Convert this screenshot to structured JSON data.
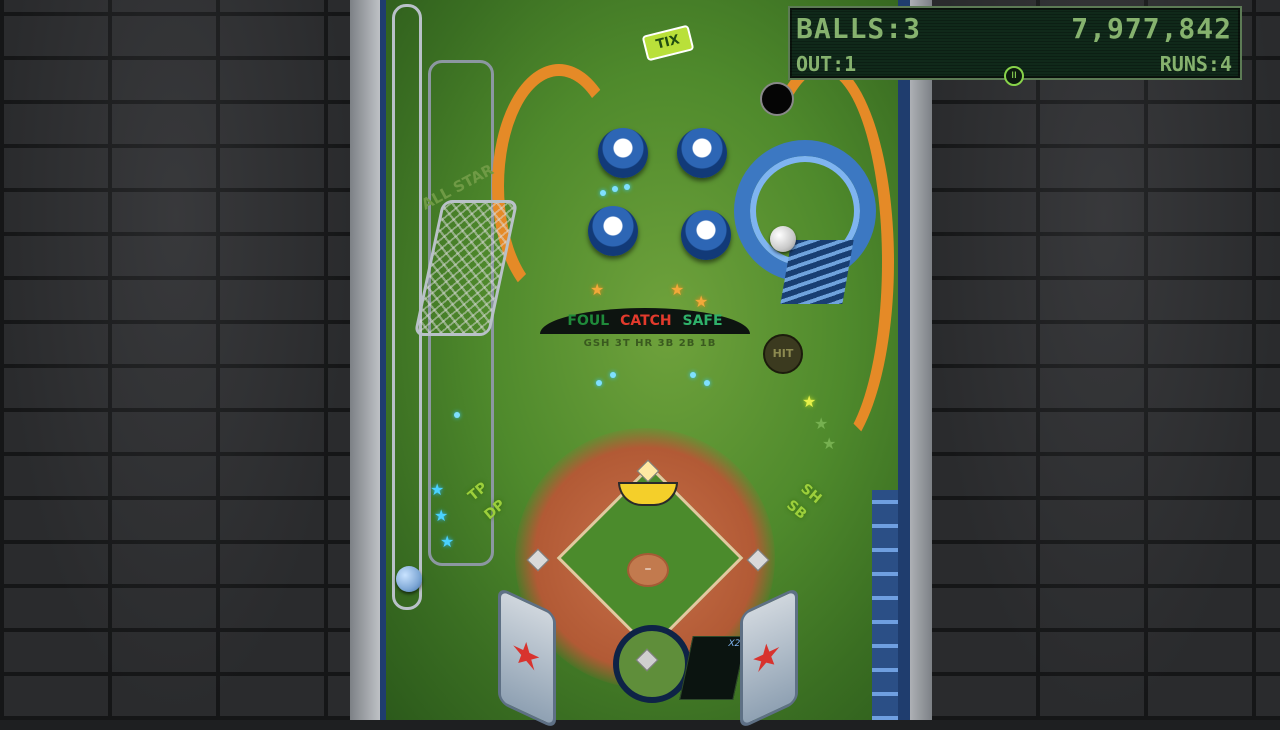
{
  "hud": {
    "balls_label": "BALLS:",
    "balls_value": "3",
    "score": "7,977,842",
    "out_label": "OUT:",
    "out_value": "1",
    "runs_label": "RUNS:",
    "runs_value": "4",
    "pause_icon": "pause-icon"
  },
  "playfield": {
    "tix_label": "TIX",
    "allstar_label": "ALL STAR",
    "arc_labels": [
      "FOUL",
      "CATCH",
      "SAFE"
    ],
    "arc_colors": [
      "#1f8a3a",
      "#e23a2c",
      "#2fb16a"
    ],
    "base_labels": "GSH 3T HR 3B 2B 1B",
    "hit_label": "HIT",
    "left_labels": [
      "TP",
      "DP"
    ],
    "right_labels": [
      "SB",
      "SH"
    ],
    "pitcher_label": "–",
    "multiplier_label": "X2"
  },
  "colors": {
    "field_green": "#4f8a2c",
    "dirt": "#b25a35",
    "hud_text": "#86b26e",
    "accent_orange": "#e58a27",
    "bumper_blue": "#2d66b5"
  }
}
